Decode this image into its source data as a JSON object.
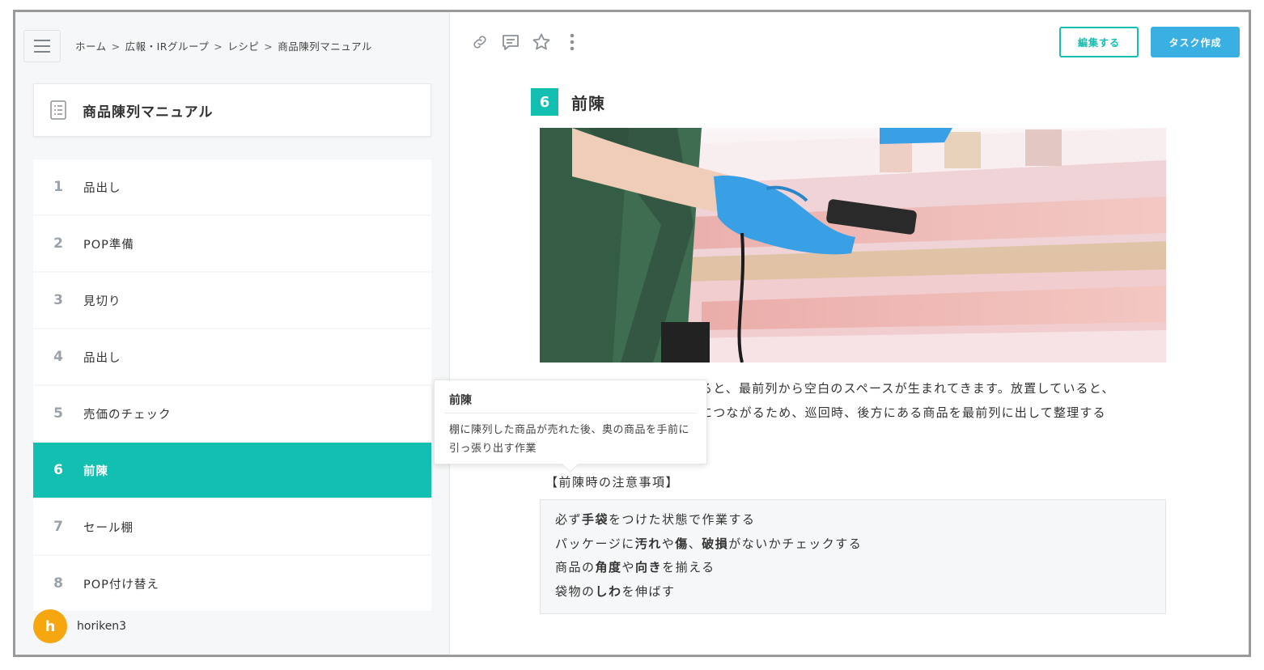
{
  "breadcrumb": [
    "ホーム",
    "広報・IRグループ",
    "レシピ",
    "商品陳列マニュアル"
  ],
  "breadcrumb_separator": ">",
  "document": {
    "title": "商品陳列マニュアル"
  },
  "steps": [
    {
      "num": "1",
      "label": "品出し"
    },
    {
      "num": "2",
      "label": "POP準備"
    },
    {
      "num": "3",
      "label": "見切り"
    },
    {
      "num": "4",
      "label": "品出し"
    },
    {
      "num": "5",
      "label": "売価のチェック"
    },
    {
      "num": "6",
      "label": "前陳"
    },
    {
      "num": "7",
      "label": "セール棚"
    },
    {
      "num": "8",
      "label": "POP付け替え"
    }
  ],
  "active_step": 6,
  "user": {
    "initial": "h",
    "name": "horiken3"
  },
  "toolbar": {
    "edit_label": "編集する",
    "task_label": "タスク作成"
  },
  "section": {
    "num": "6",
    "title": "前陳"
  },
  "body_lines": [
    "ると、最前列から空白のスペースが生まれてきます。放置していると、",
    "につながるため、巡回時、後方にある商品を最前列に出して整理する"
  ],
  "tooltip": {
    "title": "前陳",
    "body": "棚に陳列した商品が売れた後、奥の商品を手前に引っ張り出す作業"
  },
  "caution": {
    "title": "【前陳時の注意事項】",
    "lines": [
      [
        {
          "t": "必ず"
        },
        {
          "t": "手袋",
          "b": true
        },
        {
          "t": "をつけた状態で作業する"
        }
      ],
      [
        {
          "t": "パッケージに"
        },
        {
          "t": "汚れ",
          "b": true
        },
        {
          "t": "や"
        },
        {
          "t": "傷",
          "b": true
        },
        {
          "t": "、"
        },
        {
          "t": "破損",
          "b": true
        },
        {
          "t": "がないかチェックする"
        }
      ],
      [
        {
          "t": "商品の"
        },
        {
          "t": "角度",
          "b": true
        },
        {
          "t": "や"
        },
        {
          "t": "向き",
          "b": true
        },
        {
          "t": "を揃える"
        }
      ],
      [
        {
          "t": "袋物の"
        },
        {
          "t": "しわ",
          "b": true
        },
        {
          "t": "を伸ばす"
        }
      ]
    ]
  },
  "colors": {
    "accent": "#12bfb0",
    "task_button": "#3ab0e2",
    "avatar": "#f6a60f"
  },
  "icons": [
    "menu-icon",
    "document-list-icon",
    "link-icon",
    "comment-icon",
    "star-icon",
    "more-vertical-icon"
  ]
}
